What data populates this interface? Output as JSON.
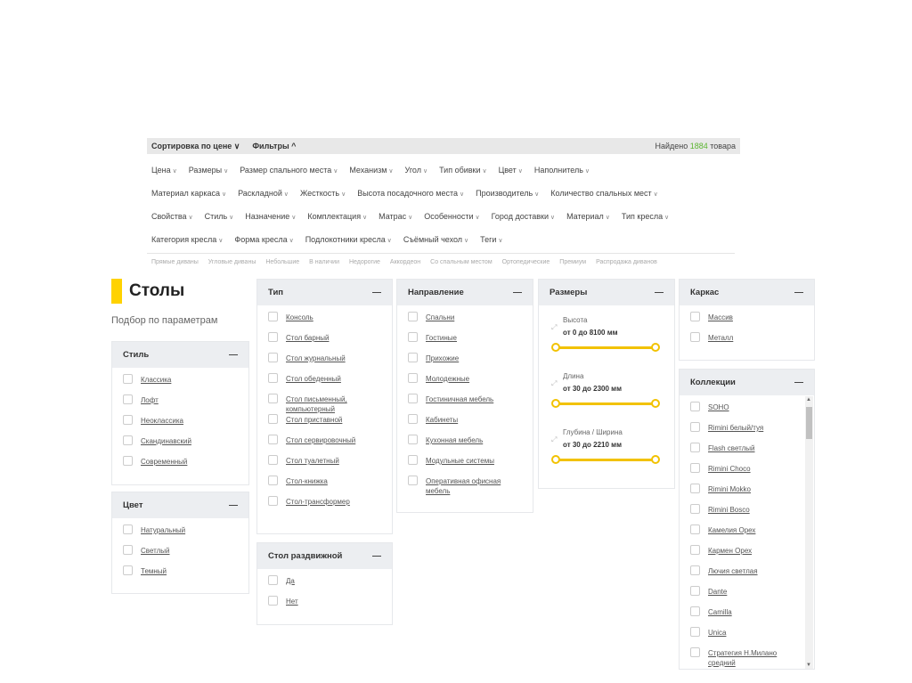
{
  "topbar": {
    "sort": "Сортировка по цене ∨",
    "filters": "Фильтры ^",
    "found_prefix": "Найдено ",
    "found_count": "1884",
    "found_suffix": " товара"
  },
  "filter_rows": [
    [
      "Цена",
      "Размеры",
      "Размер спального места",
      "Механизм",
      "Угол",
      "Тип обивки",
      "Цвет",
      "Наполнитель"
    ],
    [
      "Материал каркаса",
      "Раскладной",
      "Жесткость",
      "Высота посадочного места",
      "Производитель",
      "Количество спальных мест"
    ],
    [
      "Свойства",
      "Стиль",
      "Назначение",
      "Комплектация",
      "Матрас",
      "Особенности",
      "Город доставки",
      "Материал",
      "Тип кресла"
    ],
    [
      "Категория кресла",
      "Форма кресла",
      "Подлокотники кресла",
      "Съёмный чехол",
      "Теги"
    ]
  ],
  "tags": [
    "Прямые диваны",
    "Угловые диваны",
    "Небольшие",
    "В наличии",
    "Недорогие",
    "Аккордеон",
    "Со спальным местом",
    "Ортопедические",
    "Премиум",
    "Распродажа диванов"
  ],
  "page": {
    "title": "Столы",
    "subtitle": "Подбор по параметрам",
    "accent": "#ffd200"
  },
  "panels": {
    "style": {
      "title": "Стиль",
      "items": [
        "Классика",
        "Лофт",
        "Неоклассика",
        "Скандинавский",
        "Современный"
      ]
    },
    "color": {
      "title": "Цвет",
      "items": [
        "Натуральный",
        "Светлый",
        "Темный"
      ]
    },
    "type": {
      "title": "Тип",
      "items": [
        "Консоль",
        "Стол барный",
        "Стол журнальный",
        "Стол обеденный",
        "Стол письменный, компьютерный",
        "Стол приставной",
        "Стол сервировочный",
        "Стол туалетный",
        "Стол-книжка",
        "Стол-трансформер"
      ]
    },
    "extend": {
      "title": "Стол раздвижной",
      "items": [
        "Да",
        "Нет"
      ]
    },
    "direction": {
      "title": "Направление",
      "items": [
        "Спальни",
        "Гостиные",
        "Прихожие",
        "Молодежные",
        "Гостиничная мебель",
        "Кабинеты",
        "Кухонная мебель",
        "Модульные системы",
        "Оперативная офисная мебель"
      ]
    },
    "sizes": {
      "title": "Размеры",
      "ranges": [
        {
          "label": "Высота",
          "value": "от 0 до 8100 мм"
        },
        {
          "label": "Длина",
          "value": "от 30 до 2300 мм"
        },
        {
          "label": "Глубина / Ширина",
          "value": "от 30 до 2210 мм"
        }
      ]
    },
    "frame": {
      "title": "Каркас",
      "items": [
        "Массив",
        "Металл"
      ]
    },
    "collections": {
      "title": "Коллекции",
      "items": [
        "SOHO",
        "Rimini белый/туя",
        "Flash светлый",
        "Rimini Choco",
        "Rimini Mokko",
        "Rimini Bosco",
        "Камелия Орех",
        "Кармен Орех",
        "Лючия светлая",
        "Dante",
        "Camilla",
        "Unica",
        "Стратегия Н.Милано средний"
      ]
    }
  }
}
